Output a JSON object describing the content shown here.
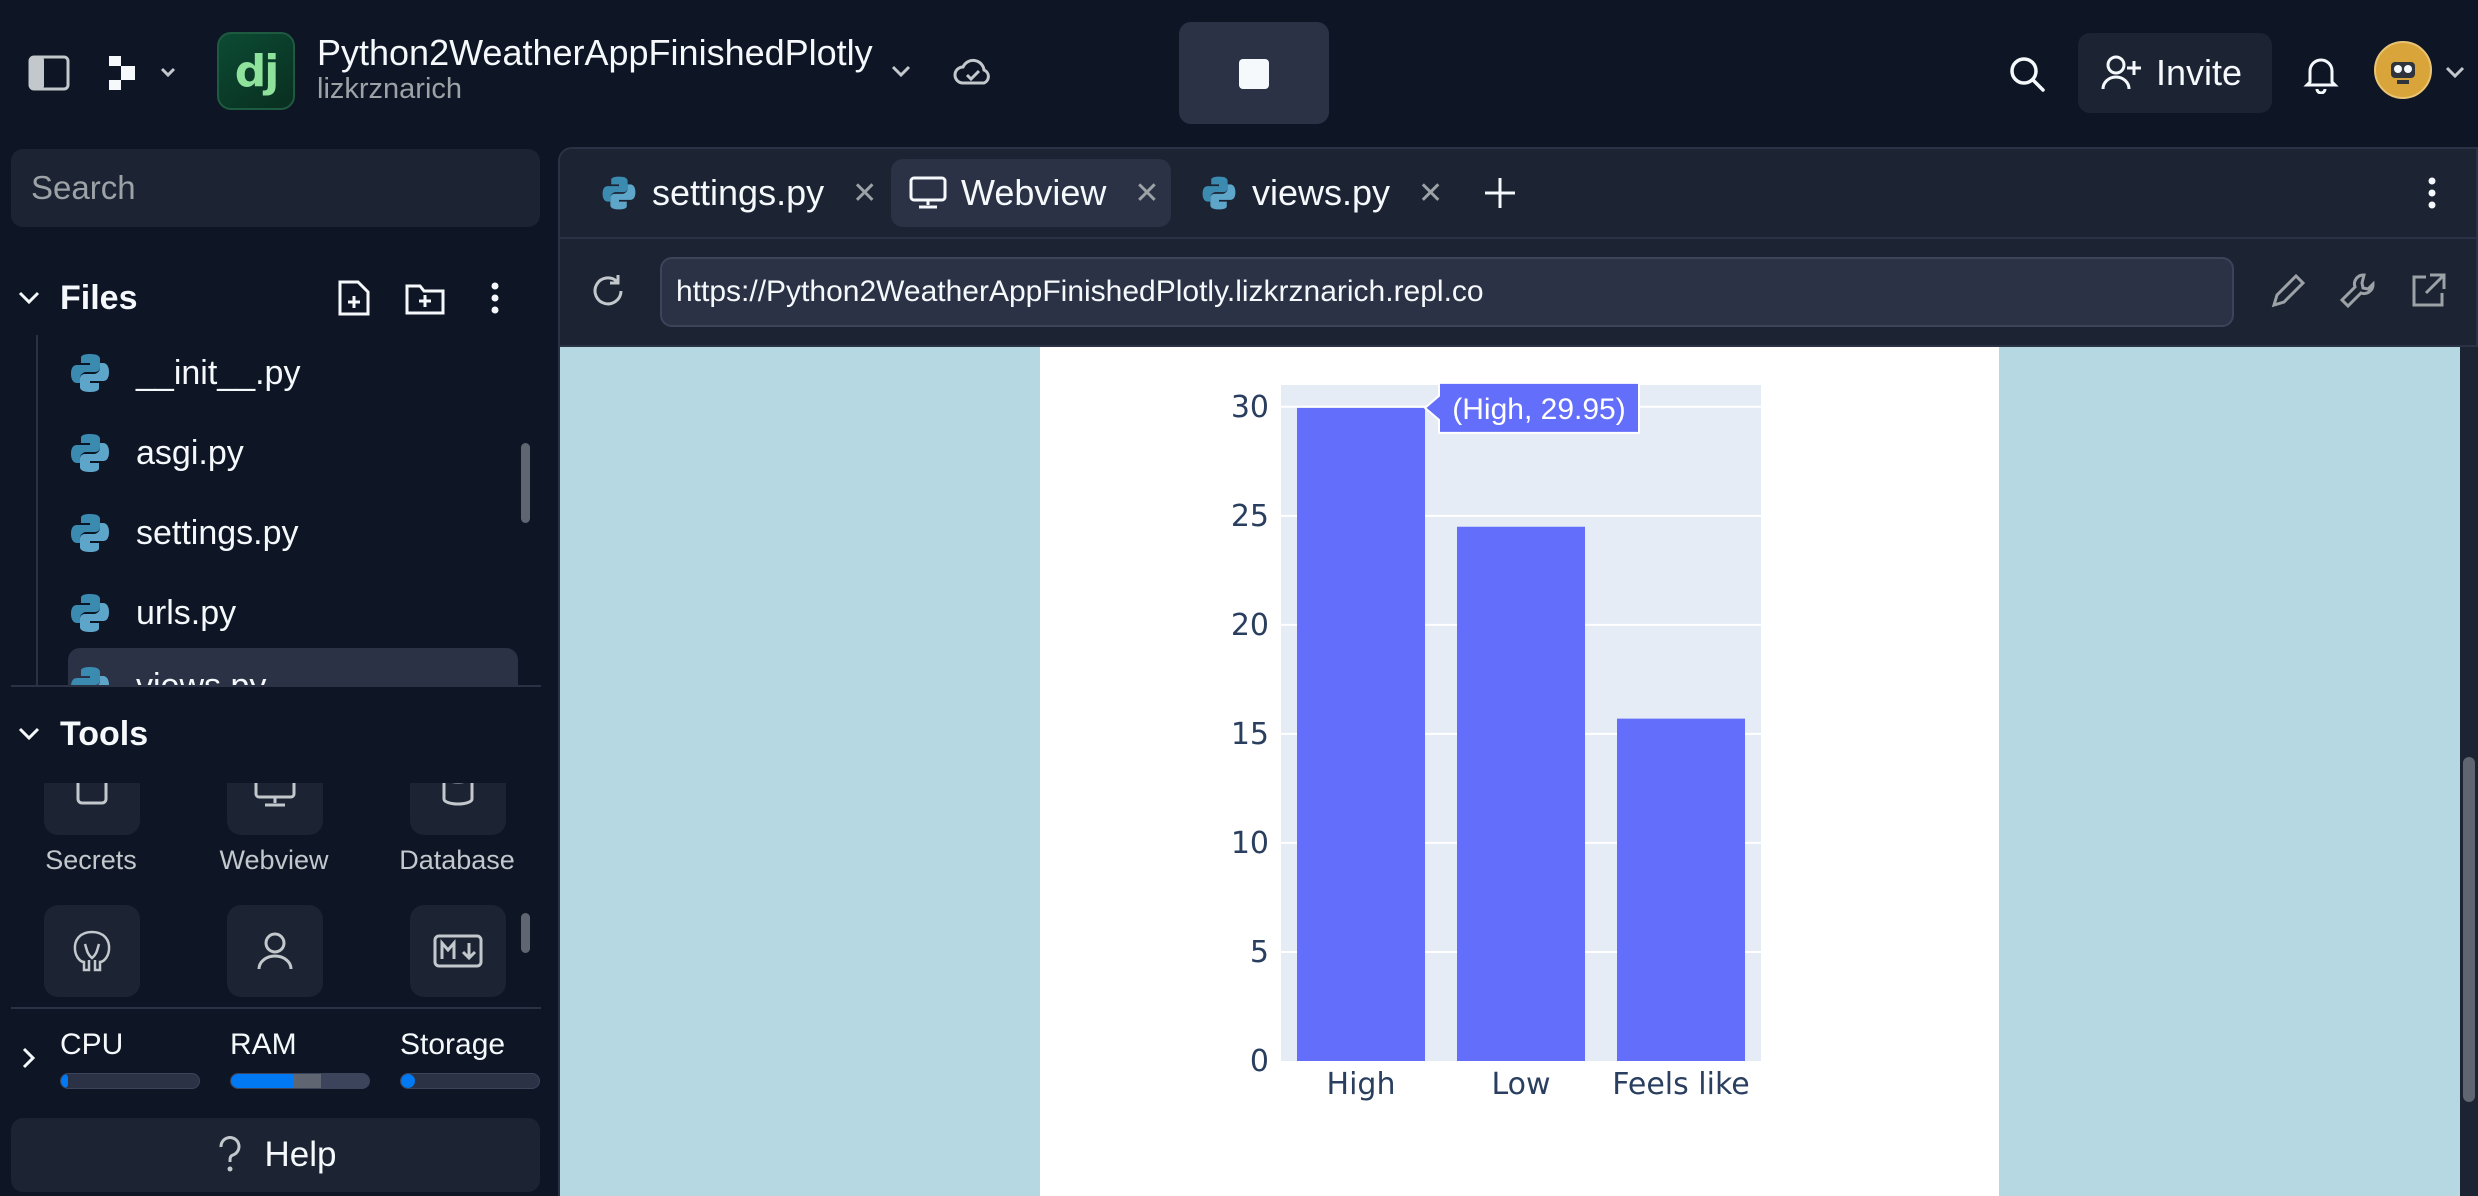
{
  "topbar": {
    "repl_logo_text": "dj",
    "repl_name": "Python2WeatherAppFinishedPlotly",
    "repl_owner": "lizkrznarich",
    "invite_label": "Invite"
  },
  "sidebar": {
    "search_placeholder": "Search",
    "files_title": "Files",
    "files": [
      "__init__.py",
      "asgi.py",
      "settings.py",
      "urls.py",
      "views.py"
    ],
    "tools_title": "Tools",
    "tools_row1": [
      "Secrets",
      "Webview",
      "Database"
    ],
    "tools_row2_icons": [
      "postgres-elephant-icon",
      "user-icon",
      "markdown-icon"
    ],
    "resources": {
      "cpu_label": "CPU",
      "ram_label": "RAM",
      "storage_label": "Storage",
      "cpu_level": 0.05,
      "ram_level": 0.45,
      "ram_secondary_level": 0.2,
      "storage_level": 0.1
    },
    "help_label": "Help"
  },
  "tabs": [
    {
      "label": "settings.py",
      "icon": "python-icon"
    },
    {
      "label": "Webview",
      "icon": "monitor-icon",
      "active": true
    },
    {
      "label": "views.py",
      "icon": "python-icon"
    }
  ],
  "urlbar": {
    "url": "https://Python2WeatherAppFinishedPlotly.lizkrznarich.repl.co"
  },
  "colors": {
    "background": "#0e1525",
    "surface": "#1c2333",
    "surface_alt": "#2b3245",
    "webview_bg": "#b5d8e2",
    "bar_color": "#636efa",
    "plot_bg": "#e5ecf6",
    "accent_blue": "#0079f2"
  },
  "chart_data": {
    "type": "bar",
    "categories": [
      "High",
      "Low",
      "Feels like"
    ],
    "values": [
      29.95,
      24.5,
      15.7
    ],
    "ylim": [
      0,
      31
    ],
    "yticks": [
      0,
      5,
      10,
      15,
      20,
      25,
      30
    ],
    "grid": true,
    "hover_label": "(High, 29.95)"
  }
}
